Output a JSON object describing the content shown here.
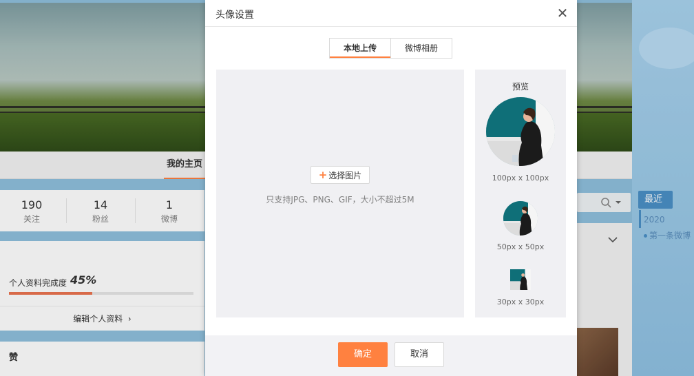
{
  "background": {
    "nav_tab_label": "我的主页",
    "stats": [
      {
        "value": "190",
        "label": "关注"
      },
      {
        "value": "14",
        "label": "粉丝"
      },
      {
        "value": "1",
        "label": "微博"
      }
    ],
    "profile_completion_label": "个人资料完成度",
    "profile_completion_value": "45%",
    "profile_completion_fraction": 0.45,
    "edit_profile_label": "编辑个人资料",
    "likes_title": "赞",
    "recent_label": "最近",
    "year_label": "2020",
    "first_post_label": "第一条微博"
  },
  "dialog": {
    "title": "头像设置",
    "close_icon": "close-icon",
    "tabs": [
      {
        "label": "本地上传",
        "active": true
      },
      {
        "label": "微博相册",
        "active": false
      }
    ],
    "select_image_label": "选择图片",
    "upload_hint": "只支持JPG、PNG、GIF，大小不超过5M",
    "preview_title": "预览",
    "preview_sizes": [
      "100px x 100px",
      "50px x 50px",
      "30px x 30px"
    ],
    "confirm_label": "确定",
    "cancel_label": "取消"
  },
  "colors": {
    "accent": "#ff8140",
    "progress": "#eb7350",
    "link_blue": "#4a90c6"
  }
}
